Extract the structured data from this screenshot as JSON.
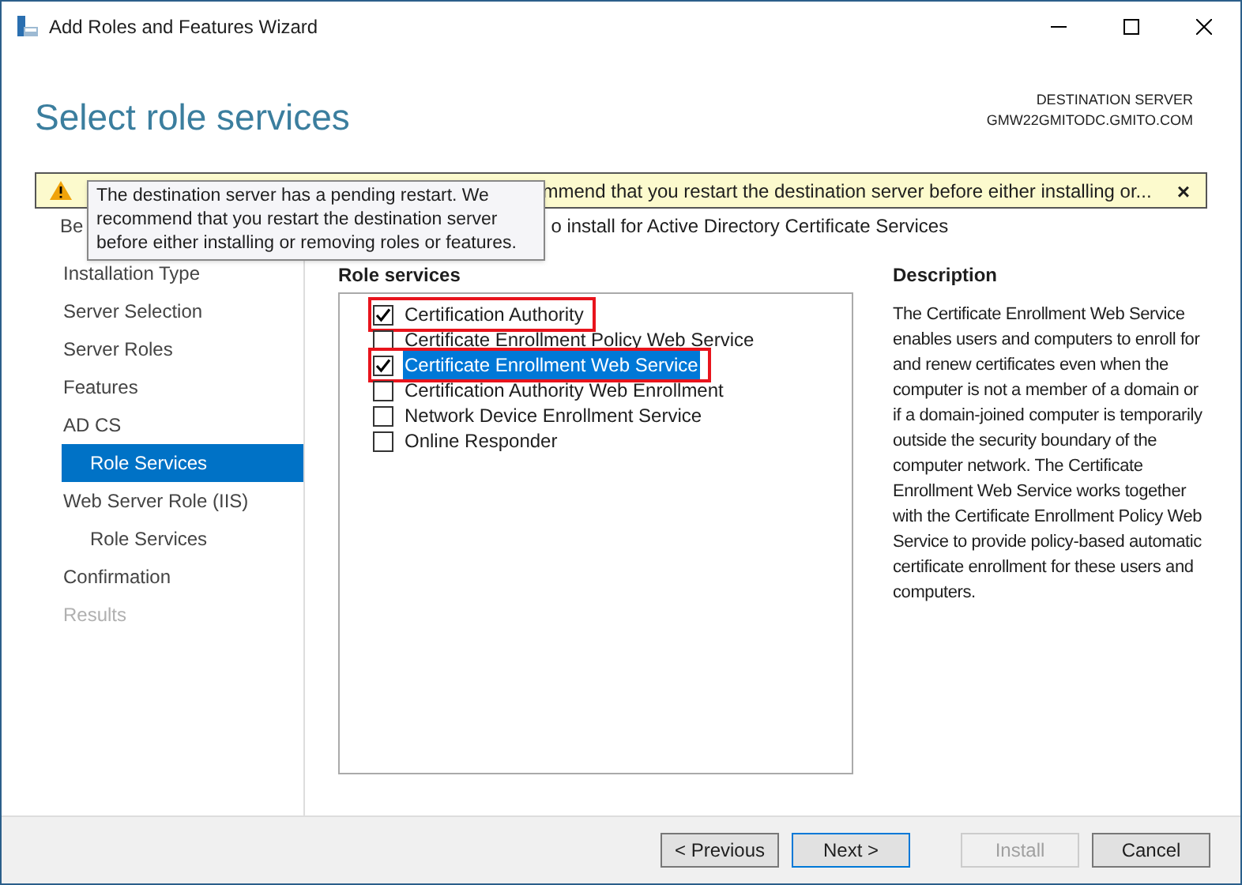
{
  "window": {
    "title": "Add Roles and Features Wizard"
  },
  "header": {
    "title": "Select role services",
    "destination_label": "DESTINATION SERVER",
    "destination_server": "GMW22GMITODC.GMITO.COM"
  },
  "warning": {
    "message": "mmend that you restart the destination server before either installing or...",
    "close": "×"
  },
  "tooltip": {
    "text": "The destination server has a pending restart. We recommend that you restart the destination server before either installing or removing roles or features."
  },
  "intro": "o install for Active Directory Certificate Services",
  "nav": [
    {
      "label": "Be",
      "selected": false,
      "disabled": false
    },
    {
      "label": "Installation Type",
      "selected": false,
      "disabled": false
    },
    {
      "label": "Server Selection",
      "selected": false,
      "disabled": false
    },
    {
      "label": "Server Roles",
      "selected": false,
      "disabled": false
    },
    {
      "label": "Features",
      "selected": false,
      "disabled": false
    },
    {
      "label": "AD CS",
      "selected": false,
      "disabled": false,
      "children": [
        {
          "label": "Role Services",
          "selected": true,
          "disabled": false
        }
      ]
    },
    {
      "label": "Web Server Role (IIS)",
      "selected": false,
      "disabled": false,
      "children": [
        {
          "label": "Role Services",
          "selected": false,
          "disabled": false
        }
      ]
    },
    {
      "label": "Confirmation",
      "selected": false,
      "disabled": false
    },
    {
      "label": "Results",
      "selected": false,
      "disabled": true
    }
  ],
  "role_services": {
    "heading": "Role services",
    "items": [
      {
        "label": "Certification Authority",
        "checked": true,
        "selected": false,
        "annotated": true
      },
      {
        "label": "Certificate Enrollment Policy Web Service",
        "checked": false,
        "selected": false,
        "annotated": false
      },
      {
        "label": "Certificate Enrollment Web Service",
        "checked": true,
        "selected": true,
        "annotated": true
      },
      {
        "label": "Certification Authority Web Enrollment",
        "checked": false,
        "selected": false,
        "annotated": false
      },
      {
        "label": "Network Device Enrollment Service",
        "checked": false,
        "selected": false,
        "annotated": false
      },
      {
        "label": "Online Responder",
        "checked": false,
        "selected": false,
        "annotated": false
      }
    ]
  },
  "description": {
    "heading": "Description",
    "text": "The Certificate Enrollment Web Service enables users and computers to enroll for and renew certificates even when the computer is not a member of a domain or if a domain-joined computer is temporarily outside the security boundary of the computer network. The Certificate Enrollment Web Service works together with the Certificate Enrollment Policy Web Service to provide policy-based automatic certificate enrollment for these users and computers."
  },
  "buttons": [
    {
      "label": "< Previous",
      "disabled": false,
      "default": false
    },
    {
      "label": "Next >",
      "disabled": false,
      "default": true
    },
    {
      "label": "Install",
      "disabled": true,
      "default": false
    },
    {
      "label": "Cancel",
      "disabled": false,
      "default": false
    }
  ]
}
